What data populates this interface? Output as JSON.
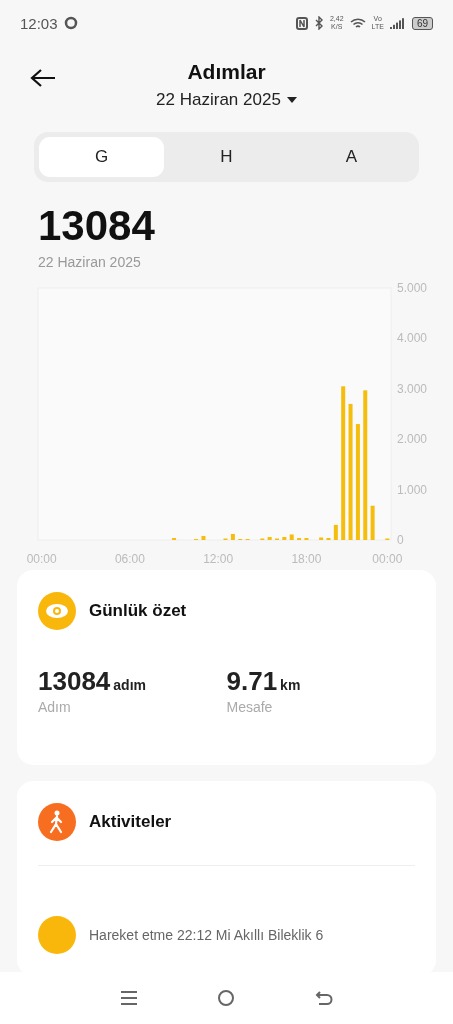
{
  "status_bar": {
    "time": "12:03",
    "data_rate": "2,42",
    "data_unit": "K/S",
    "network_top": "Vo",
    "network_bottom": "LTE",
    "battery": "69"
  },
  "header": {
    "title": "Adımlar",
    "date": "22 Haziran 2025"
  },
  "tabs": [
    {
      "label": "G",
      "selected": true
    },
    {
      "label": "H",
      "selected": false
    },
    {
      "label": "A",
      "selected": false
    }
  ],
  "total": {
    "value": "13084",
    "date": "22 Haziran 2025"
  },
  "chart_data": {
    "type": "bar",
    "categories": [
      "00:00",
      null,
      null,
      null,
      null,
      null,
      null,
      null,
      null,
      null,
      null,
      null,
      "06:00",
      null,
      null,
      null,
      null,
      null,
      null,
      null,
      null,
      null,
      null,
      null,
      "12:00",
      null,
      null,
      null,
      null,
      null,
      null,
      null,
      null,
      null,
      null,
      null,
      "18:00",
      null,
      null,
      null,
      null,
      null,
      null,
      null,
      null,
      null,
      null,
      "00:00"
    ],
    "series": [
      {
        "color": "#f5bd0c",
        "values": [
          0,
          0,
          0,
          0,
          0,
          0,
          0,
          0,
          0,
          0,
          0,
          0,
          0,
          0,
          0,
          0,
          0,
          0,
          0.04,
          0,
          0,
          0.02,
          0.08,
          0,
          0,
          0.03,
          0.12,
          0.02,
          0.02,
          0,
          0.03,
          0.06,
          0.03,
          0.06,
          0.11,
          0.04,
          0.04,
          0,
          0.05,
          0.04,
          0.3,
          3.05,
          2.7,
          2.3,
          2.97,
          0.68,
          0,
          0.03
        ]
      }
    ],
    "ylim": [
      0,
      5
    ],
    "yticks": [
      {
        "value": 0,
        "label": "0"
      },
      {
        "value": 1,
        "label": "1.000"
      },
      {
        "value": 2,
        "label": "2.000"
      },
      {
        "value": 3,
        "label": "3.000"
      },
      {
        "value": 4,
        "label": "4.000"
      },
      {
        "value": 5,
        "label": "5.000"
      }
    ]
  },
  "summary": {
    "title": "Günlük özet",
    "stats": [
      {
        "value": "13084",
        "unit": "adım",
        "label": "Adım"
      },
      {
        "value": "9.71",
        "unit": "km",
        "label": "Mesafe"
      }
    ]
  },
  "activities": {
    "title": "Aktiviteler",
    "items": [
      {
        "text": "Hareket etme 22:12 Mi Akıllı Bileklik 6"
      }
    ]
  }
}
